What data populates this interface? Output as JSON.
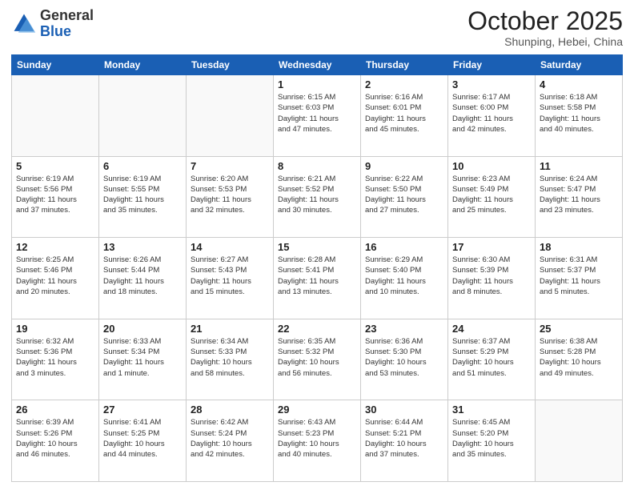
{
  "header": {
    "logo_general": "General",
    "logo_blue": "Blue",
    "month": "October 2025",
    "location": "Shunping, Hebei, China"
  },
  "days_of_week": [
    "Sunday",
    "Monday",
    "Tuesday",
    "Wednesday",
    "Thursday",
    "Friday",
    "Saturday"
  ],
  "weeks": [
    [
      {
        "day": "",
        "info": ""
      },
      {
        "day": "",
        "info": ""
      },
      {
        "day": "",
        "info": ""
      },
      {
        "day": "1",
        "info": "Sunrise: 6:15 AM\nSunset: 6:03 PM\nDaylight: 11 hours\nand 47 minutes."
      },
      {
        "day": "2",
        "info": "Sunrise: 6:16 AM\nSunset: 6:01 PM\nDaylight: 11 hours\nand 45 minutes."
      },
      {
        "day": "3",
        "info": "Sunrise: 6:17 AM\nSunset: 6:00 PM\nDaylight: 11 hours\nand 42 minutes."
      },
      {
        "day": "4",
        "info": "Sunrise: 6:18 AM\nSunset: 5:58 PM\nDaylight: 11 hours\nand 40 minutes."
      }
    ],
    [
      {
        "day": "5",
        "info": "Sunrise: 6:19 AM\nSunset: 5:56 PM\nDaylight: 11 hours\nand 37 minutes."
      },
      {
        "day": "6",
        "info": "Sunrise: 6:19 AM\nSunset: 5:55 PM\nDaylight: 11 hours\nand 35 minutes."
      },
      {
        "day": "7",
        "info": "Sunrise: 6:20 AM\nSunset: 5:53 PM\nDaylight: 11 hours\nand 32 minutes."
      },
      {
        "day": "8",
        "info": "Sunrise: 6:21 AM\nSunset: 5:52 PM\nDaylight: 11 hours\nand 30 minutes."
      },
      {
        "day": "9",
        "info": "Sunrise: 6:22 AM\nSunset: 5:50 PM\nDaylight: 11 hours\nand 27 minutes."
      },
      {
        "day": "10",
        "info": "Sunrise: 6:23 AM\nSunset: 5:49 PM\nDaylight: 11 hours\nand 25 minutes."
      },
      {
        "day": "11",
        "info": "Sunrise: 6:24 AM\nSunset: 5:47 PM\nDaylight: 11 hours\nand 23 minutes."
      }
    ],
    [
      {
        "day": "12",
        "info": "Sunrise: 6:25 AM\nSunset: 5:46 PM\nDaylight: 11 hours\nand 20 minutes."
      },
      {
        "day": "13",
        "info": "Sunrise: 6:26 AM\nSunset: 5:44 PM\nDaylight: 11 hours\nand 18 minutes."
      },
      {
        "day": "14",
        "info": "Sunrise: 6:27 AM\nSunset: 5:43 PM\nDaylight: 11 hours\nand 15 minutes."
      },
      {
        "day": "15",
        "info": "Sunrise: 6:28 AM\nSunset: 5:41 PM\nDaylight: 11 hours\nand 13 minutes."
      },
      {
        "day": "16",
        "info": "Sunrise: 6:29 AM\nSunset: 5:40 PM\nDaylight: 11 hours\nand 10 minutes."
      },
      {
        "day": "17",
        "info": "Sunrise: 6:30 AM\nSunset: 5:39 PM\nDaylight: 11 hours\nand 8 minutes."
      },
      {
        "day": "18",
        "info": "Sunrise: 6:31 AM\nSunset: 5:37 PM\nDaylight: 11 hours\nand 5 minutes."
      }
    ],
    [
      {
        "day": "19",
        "info": "Sunrise: 6:32 AM\nSunset: 5:36 PM\nDaylight: 11 hours\nand 3 minutes."
      },
      {
        "day": "20",
        "info": "Sunrise: 6:33 AM\nSunset: 5:34 PM\nDaylight: 11 hours\nand 1 minute."
      },
      {
        "day": "21",
        "info": "Sunrise: 6:34 AM\nSunset: 5:33 PM\nDaylight: 10 hours\nand 58 minutes."
      },
      {
        "day": "22",
        "info": "Sunrise: 6:35 AM\nSunset: 5:32 PM\nDaylight: 10 hours\nand 56 minutes."
      },
      {
        "day": "23",
        "info": "Sunrise: 6:36 AM\nSunset: 5:30 PM\nDaylight: 10 hours\nand 53 minutes."
      },
      {
        "day": "24",
        "info": "Sunrise: 6:37 AM\nSunset: 5:29 PM\nDaylight: 10 hours\nand 51 minutes."
      },
      {
        "day": "25",
        "info": "Sunrise: 6:38 AM\nSunset: 5:28 PM\nDaylight: 10 hours\nand 49 minutes."
      }
    ],
    [
      {
        "day": "26",
        "info": "Sunrise: 6:39 AM\nSunset: 5:26 PM\nDaylight: 10 hours\nand 46 minutes."
      },
      {
        "day": "27",
        "info": "Sunrise: 6:41 AM\nSunset: 5:25 PM\nDaylight: 10 hours\nand 44 minutes."
      },
      {
        "day": "28",
        "info": "Sunrise: 6:42 AM\nSunset: 5:24 PM\nDaylight: 10 hours\nand 42 minutes."
      },
      {
        "day": "29",
        "info": "Sunrise: 6:43 AM\nSunset: 5:23 PM\nDaylight: 10 hours\nand 40 minutes."
      },
      {
        "day": "30",
        "info": "Sunrise: 6:44 AM\nSunset: 5:21 PM\nDaylight: 10 hours\nand 37 minutes."
      },
      {
        "day": "31",
        "info": "Sunrise: 6:45 AM\nSunset: 5:20 PM\nDaylight: 10 hours\nand 35 minutes."
      },
      {
        "day": "",
        "info": ""
      }
    ]
  ]
}
